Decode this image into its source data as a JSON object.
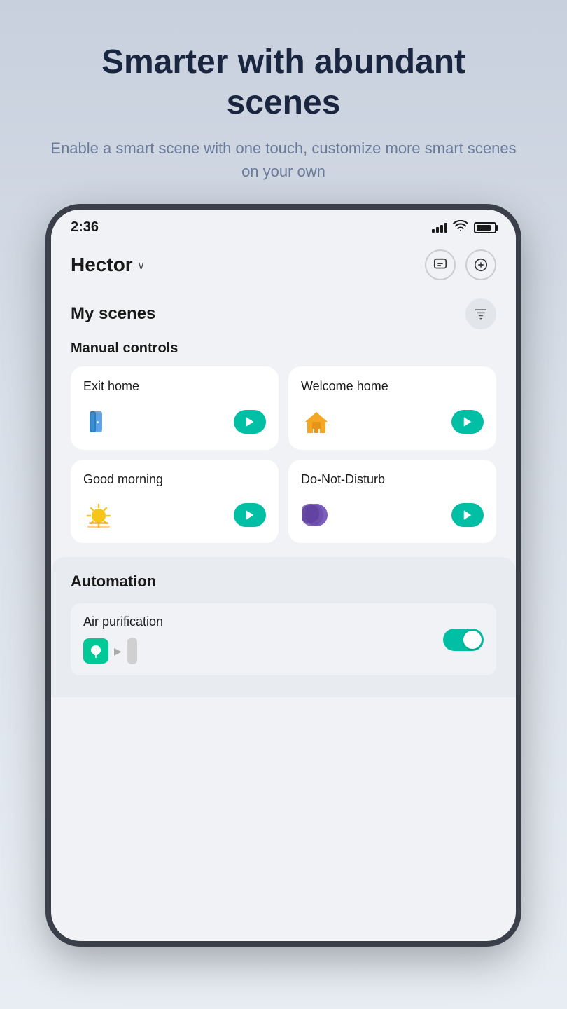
{
  "hero": {
    "title": "Smarter with abundant scenes",
    "subtitle": "Enable a smart scene with one touch, customize more smart scenes on your own"
  },
  "status_bar": {
    "time": "2:36"
  },
  "header": {
    "home_name": "Hector",
    "chevron": "∨",
    "message_icon": "message",
    "add_icon": "add"
  },
  "scenes_section": {
    "title": "My scenes",
    "manual_controls_title": "Manual controls",
    "scenes": [
      {
        "id": "exit-home",
        "name": "Exit home",
        "icon": "🚪"
      },
      {
        "id": "welcome-home",
        "name": "Welcome home",
        "icon": "🏠"
      },
      {
        "id": "good-morning",
        "name": "Good morning",
        "icon": "🌅"
      },
      {
        "id": "do-not-disturb",
        "name": "Do-Not-Disturb",
        "icon": "🌙"
      }
    ]
  },
  "automation_section": {
    "title": "Automation",
    "items": [
      {
        "id": "air-purification",
        "name": "Air purification",
        "enabled": true
      }
    ]
  },
  "run_button_label": "▶"
}
